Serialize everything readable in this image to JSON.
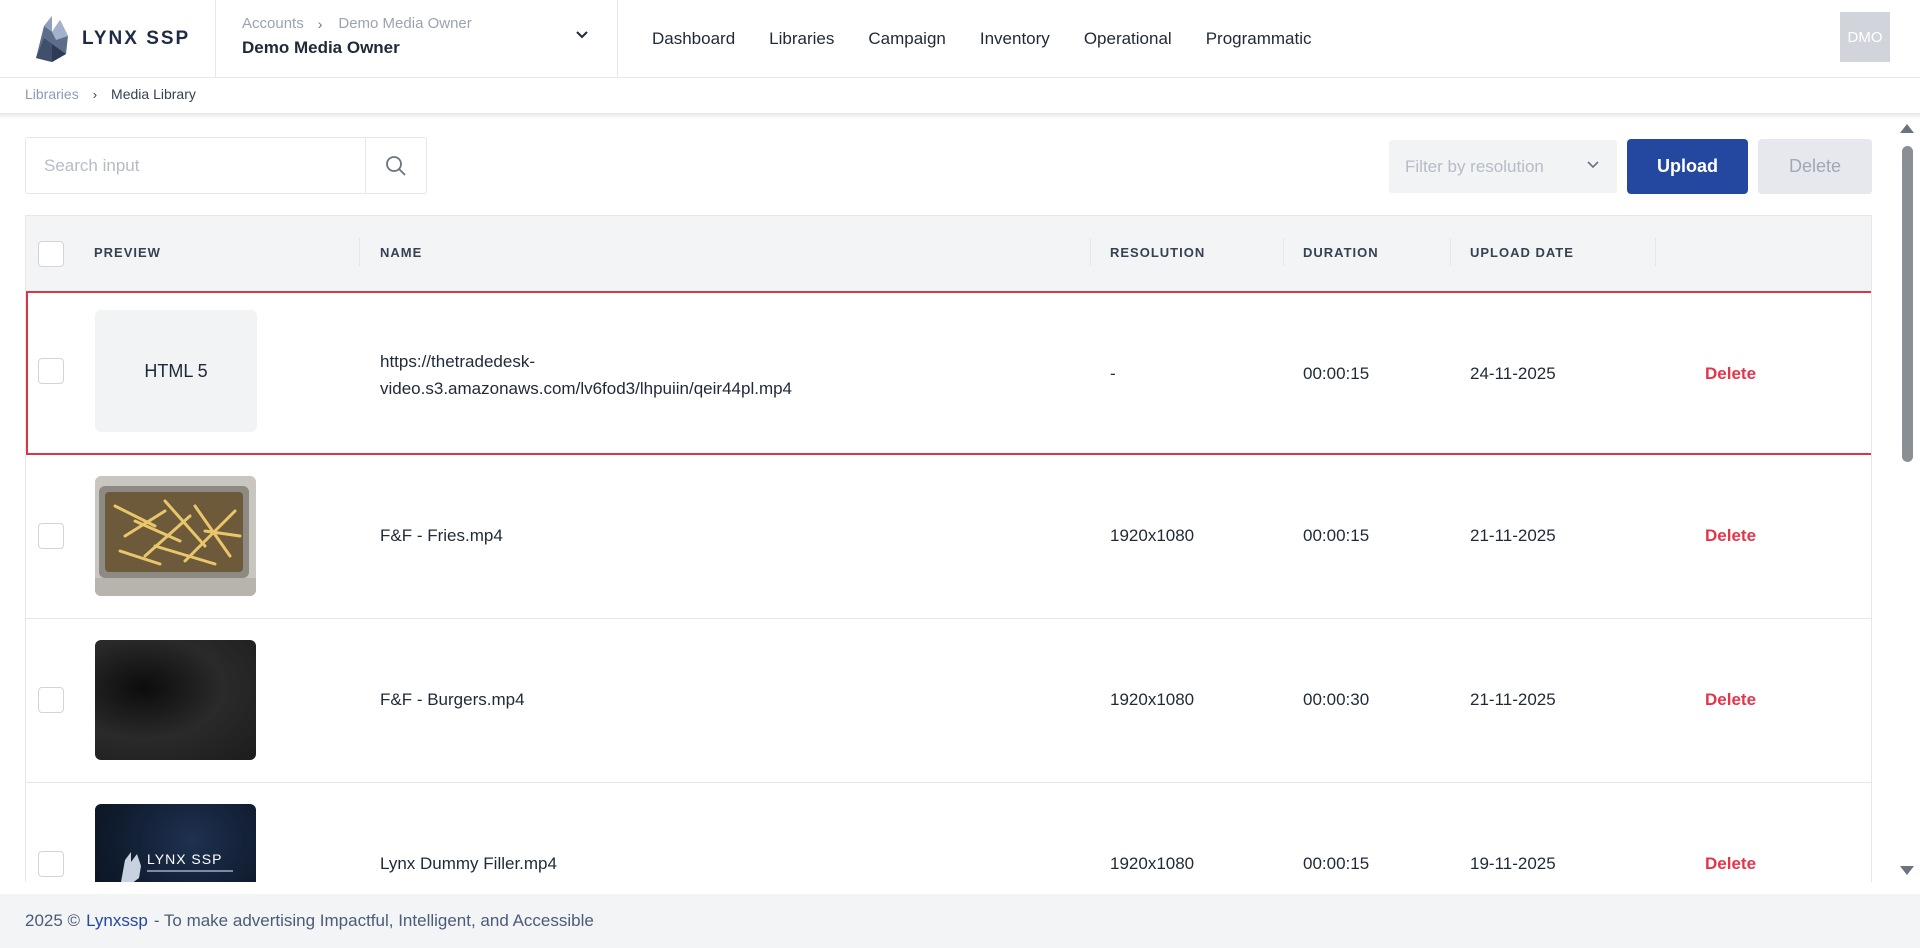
{
  "header": {
    "logo_text": "LYNX SSP",
    "account_crumb_1": "Accounts",
    "account_crumb_2": "Demo Media Owner",
    "account_name": "Demo Media Owner",
    "nav": [
      "Dashboard",
      "Libraries",
      "Campaign",
      "Inventory",
      "Operational",
      "Programmatic"
    ],
    "avatar_initials": "DMO"
  },
  "breadcrumb": {
    "parent": "Libraries",
    "current": "Media Library"
  },
  "toolbar": {
    "search_placeholder": "Search input",
    "search_value": "",
    "filter_placeholder": "Filter by resolution",
    "upload_label": "Upload",
    "delete_label": "Delete"
  },
  "table": {
    "headers": [
      "PREVIEW",
      "NAME",
      "RESOLUTION",
      "DURATION",
      "UPLOAD DATE"
    ],
    "rows": [
      {
        "preview_text": "HTML 5",
        "preview_kind": "html5",
        "name_line1": "https://thetradedesk-",
        "name_line2": "video.s3.amazonaws.com/lv6fod3/lhpuiin/qeir44pl.mp4",
        "resolution": "-",
        "duration": "00:00:15",
        "upload_date": "24-11-2025",
        "action": "Delete",
        "selected": true
      },
      {
        "preview_kind": "fries-image",
        "name_line1": "F&F - Fries.mp4",
        "resolution": "1920x1080",
        "duration": "00:00:15",
        "upload_date": "21-11-2025",
        "action": "Delete"
      },
      {
        "preview_kind": "dark-image",
        "name_line1": "F&F - Burgers.mp4",
        "resolution": "1920x1080",
        "duration": "00:00:30",
        "upload_date": "21-11-2025",
        "action": "Delete"
      },
      {
        "preview_kind": "lynx-logo-image",
        "preview_logo_text": "LYNX SSP",
        "name_line1": "Lynx Dummy Filler.mp4",
        "resolution": "1920x1080",
        "duration": "00:00:15",
        "upload_date": "19-11-2025",
        "action": "Delete"
      }
    ]
  },
  "footer": {
    "prefix": "2025 ©",
    "brand": "Lynxssp",
    "tagline": "- To make advertising Impactful, Intelligent, and Accessible"
  },
  "colors": {
    "primary": "#2447a0",
    "danger": "#e3364b",
    "selected_border": "#dc3545"
  }
}
